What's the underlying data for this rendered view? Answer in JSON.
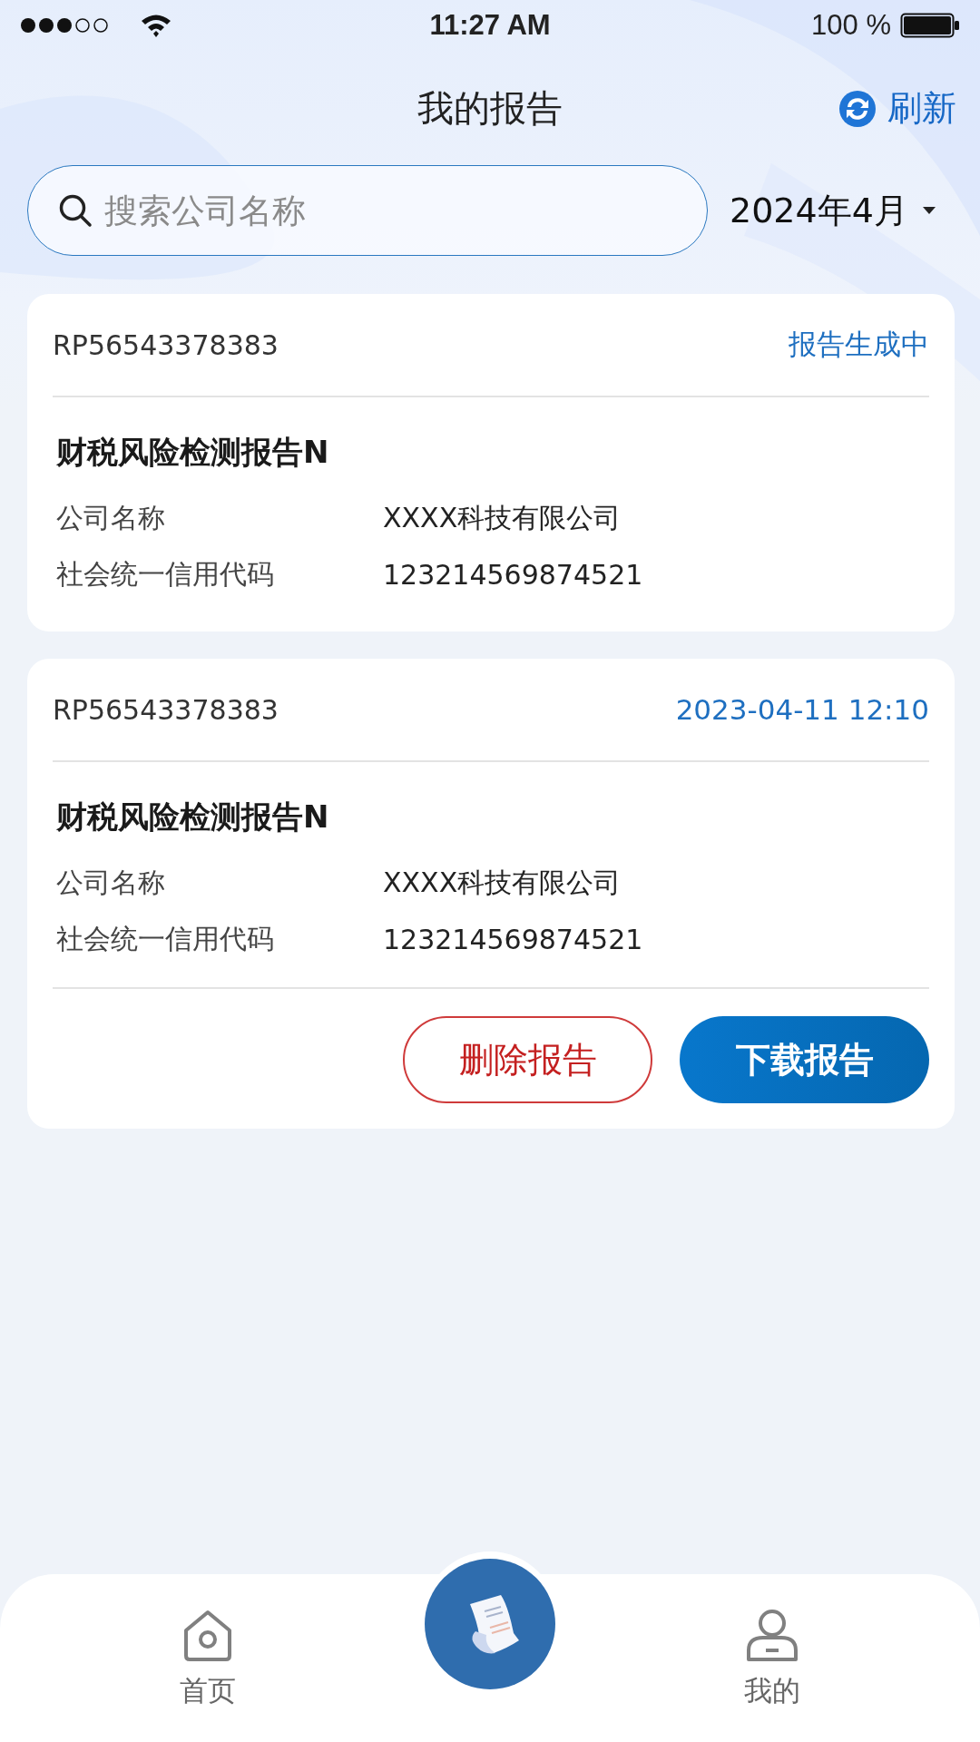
{
  "status_bar": {
    "time": "11:27 AM",
    "battery": "100 %"
  },
  "header": {
    "title": "我的报告",
    "refresh": "刷新"
  },
  "search": {
    "placeholder": "搜索公司名称"
  },
  "date_filter": {
    "label": "2024年4月"
  },
  "reports": [
    {
      "id": "RP56543378383",
      "status": "报告生成中",
      "title": "财税风险检测报告N",
      "fields": [
        {
          "label": "公司名称",
          "value": "XXXX科技有限公司"
        },
        {
          "label": "社会统一信用代码",
          "value": "123214569874521"
        }
      ]
    },
    {
      "id": "RP56543378383",
      "status": "2023-04-11 12:10",
      "title": "财税风险检测报告N",
      "fields": [
        {
          "label": "公司名称",
          "value": "XXXX科技有限公司"
        },
        {
          "label": "社会统一信用代码",
          "value": "123214569874521"
        }
      ],
      "actions": [
        {
          "label": "删除报告",
          "kind": "danger"
        },
        {
          "label": "下载报告",
          "kind": "primary"
        }
      ]
    }
  ],
  "tab_bar": [
    {
      "label": "首页",
      "kind": "home"
    },
    {
      "kind": "center"
    },
    {
      "label": "我的",
      "kind": "profile"
    }
  ]
}
